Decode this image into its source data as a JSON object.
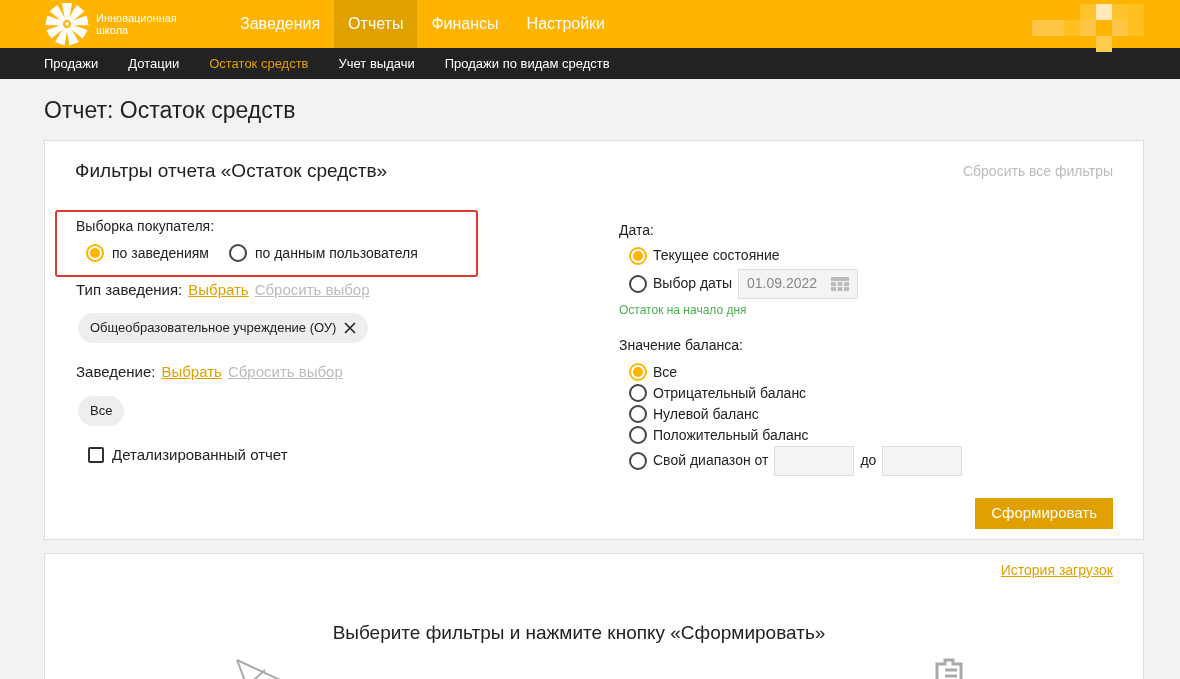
{
  "header": {
    "logo_lines": [
      "Инновационная",
      "школа"
    ],
    "nav": [
      {
        "label": "Заведения",
        "selected": false
      },
      {
        "label": "Отчеты",
        "selected": true
      },
      {
        "label": "Финансы",
        "selected": false
      },
      {
        "label": "Настройки",
        "selected": false
      }
    ]
  },
  "subnav": [
    {
      "label": "Продажи",
      "selected": false
    },
    {
      "label": "Дотации",
      "selected": false
    },
    {
      "label": "Остаток средств",
      "selected": true
    },
    {
      "label": "Учет выдачи",
      "selected": false
    },
    {
      "label": "Продажи по видам средств",
      "selected": false
    }
  ],
  "page_title": "Отчет: Остаток средств",
  "filters": {
    "title": "Фильтры отчета «Остаток средств»",
    "reset_all": "Сбросить все фильтры",
    "buyer_selection": {
      "label": "Выборка покупателя:",
      "options": [
        {
          "label": "по заведениям",
          "selected": true
        },
        {
          "label": "по данным пользователя",
          "selected": false
        }
      ]
    },
    "venue_type": {
      "label": "Тип заведения:",
      "choose": "Выбрать",
      "reset": "Сбросить выбор",
      "chips": [
        {
          "label": "Общеобразовательное учреждение (ОУ)",
          "removable": true
        }
      ]
    },
    "venue": {
      "label": "Заведение:",
      "choose": "Выбрать",
      "reset": "Сбросить выбор",
      "chips": [
        {
          "label": "Все",
          "removable": false
        }
      ]
    },
    "detailed": {
      "label": "Детализированный отчет",
      "checked": false
    },
    "date": {
      "label": "Дата:",
      "options": [
        {
          "kind": "plain",
          "label": "Текущее состояние",
          "selected": true
        },
        {
          "kind": "date",
          "label": "Выбор даты",
          "selected": false,
          "value": "01.09.2022"
        }
      ],
      "hint": "Остаток на начало дня"
    },
    "balance": {
      "label": "Значение баланса:",
      "options": [
        {
          "kind": "plain",
          "label": "Все",
          "selected": true
        },
        {
          "kind": "plain",
          "label": "Отрицательный баланс",
          "selected": false
        },
        {
          "kind": "plain",
          "label": "Нулевой баланс",
          "selected": false
        },
        {
          "kind": "plain",
          "label": "Положительный баланс",
          "selected": false
        },
        {
          "kind": "range",
          "label": "Свой диапазон от",
          "separator": "до",
          "selected": false
        }
      ]
    },
    "submit": "Сформировать"
  },
  "results": {
    "history_link": "История загрузок",
    "message": "Выберите фильтры и нажмите кнопку «Сформировать»"
  }
}
